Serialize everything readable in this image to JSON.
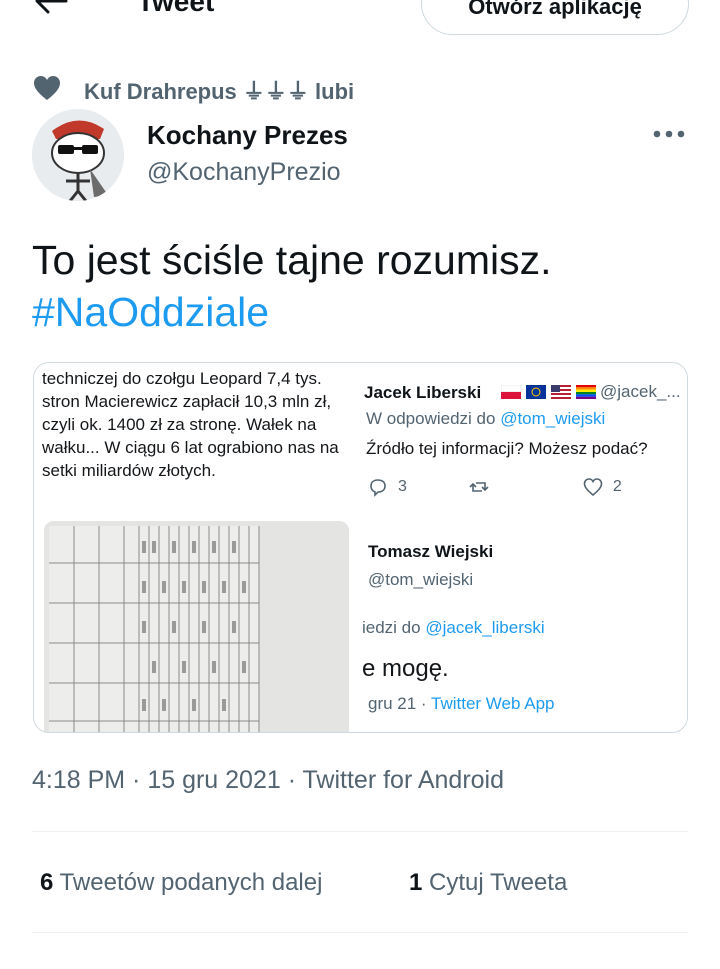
{
  "header": {
    "title": "Tweet",
    "open_app_label": "Otwórz aplikację"
  },
  "social_context": {
    "text": "Kuf Drahrepus ⏚⏚⏚ lubi"
  },
  "author": {
    "name": "Kochany Prezes",
    "handle": "@KochanyPrezio"
  },
  "tweet": {
    "text": "To jest ściśle tajne rozumisz.",
    "hashtag": "#NaOddziale"
  },
  "embedded_image": {
    "left_text": "techniczej do czołgu Leopard 7,4 tys. stron Macierewicz zapłacił 10,3 mln zł, czyli ok. 1400 zł za stronę. Wałek na wałku... W ciągu 6 lat ograbiono nas na setki miliardów złotych.",
    "reply1": {
      "name": "Jacek Liberski",
      "handle": "@jacek_...",
      "reply_prefix": "W odpowiedzi do ",
      "reply_mention": "@tom_wiejski",
      "text": "Źródło tej informacji? Możesz podać?",
      "replies": "3",
      "likes": "2"
    },
    "reply2": {
      "name": "Tomasz Wiejski",
      "handle": "@tom_wiejski",
      "reply_prefix": "iedzi do ",
      "reply_mention": "@jacek_liberski",
      "text": "e mogę.",
      "meta_prefix": "gru 21 · ",
      "meta_app": "Twitter Web App"
    }
  },
  "meta": {
    "timestamp": "4:18 PM · 15 gru 2021 · Twitter for Android"
  },
  "stats": {
    "retweets_count": "6",
    "retweets_label": "Tweetów podanych dalej",
    "quotes_count": "1",
    "quotes_label": "Cytuj Tweeta"
  },
  "colors": {
    "accent": "#1d9bf0",
    "secondary_text": "#536471",
    "border": "#cfd9de"
  },
  "icons": {
    "back": "arrow-left-icon",
    "liked": "heart-icon",
    "more": "more-horizontal-icon",
    "reply": "reply-icon",
    "retweet": "retweet-icon",
    "like": "like-icon"
  }
}
